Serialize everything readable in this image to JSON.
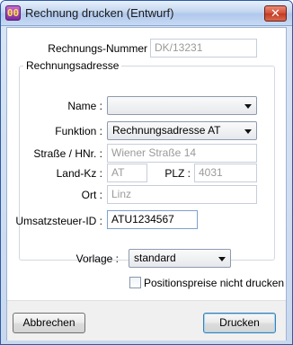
{
  "window": {
    "title": "Rechnung drucken (Entwurf)",
    "close_glyph": "✕",
    "app_icon_glyph": "00"
  },
  "form": {
    "rechnungsnummer_label": "Rechnungs-Nummer",
    "rechnungsnummer_value": "DK/13231",
    "address_group_title": "Rechnungsadresse",
    "name_label": "Name :",
    "name_value": "",
    "funktion_label": "Funktion :",
    "funktion_value": "Rechnungsadresse AT",
    "strasse_label": "Straße / HNr. :",
    "strasse_value": "Wiener Straße 14",
    "landkz_label": "Land-Kz :",
    "landkz_value": "AT",
    "plz_label": "PLZ :",
    "plz_value": "4031",
    "ort_label": "Ort :",
    "ort_value": "Linz",
    "ust_label": "Umsatzsteuer-ID :",
    "ust_value": "ATU1234567",
    "vorlage_label": "Vorlage :",
    "vorlage_value": "standard",
    "positionspreise_label": "Positionspreise nicht drucken",
    "positionspreise_checked": false
  },
  "buttons": {
    "abbrechen": "Abbrechen",
    "drucken": "Drucken"
  },
  "colors": {
    "titlebar": "#c3d6f0",
    "close": "#d24e35",
    "default_button_border": "#3c7fb1"
  }
}
